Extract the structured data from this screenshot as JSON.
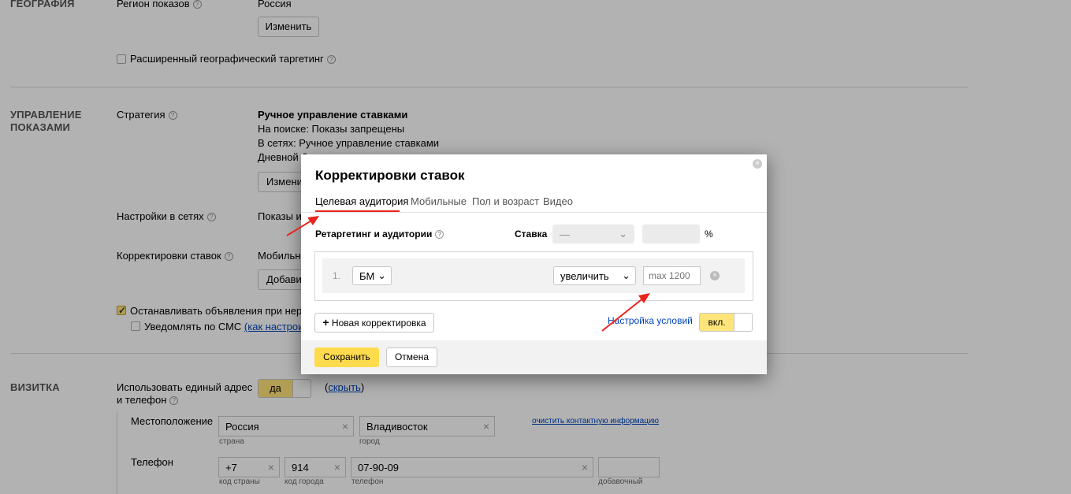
{
  "geo": {
    "section_title": "ГЕОГРАФИЯ",
    "region_label": "Регион показов",
    "region_value": "Россия",
    "change_button": "Изменить",
    "extended_targeting_label": "Расширенный географический таргетинг"
  },
  "management": {
    "section_title_line1": "УПРАВЛЕНИЕ",
    "section_title_line2": "ПОКАЗАМИ",
    "strategy_label": "Стратегия",
    "strategy_title": "Ручное управление ставками",
    "strategy_search": "На поиске: Показы запрещены",
    "strategy_networks": "В сетях: Ручное управление ставками",
    "strategy_daily": "Дневной б...",
    "change_button": "Измени",
    "networks_label": "Настройки в сетях",
    "networks_value": "Показы ид",
    "bid_adjust_label": "Корректировки ставок",
    "bid_adjust_value": "Мобильны",
    "add_button": "Добави",
    "stop_ads_label": "Останавливать объявления при неработ",
    "sms_label": "Уведомлять по СМС",
    "sms_link": "(как настроить?"
  },
  "card": {
    "section_title": "ВИЗИТКА",
    "use_single_label_line1": "Использовать единый адрес",
    "use_single_label_line2": "и телефон",
    "toggle_value": "да",
    "hide_link": "скрыть",
    "hide_open": "(",
    "hide_close": ")",
    "location_label": "Местоположение",
    "country_value": "Россия",
    "country_caption": "страна",
    "city_value": "Владивосток",
    "city_caption": "город",
    "clear_link": "очистить контактную информацию",
    "phone_label": "Телефон",
    "country_code_value": "+7",
    "country_code_caption": "код страны",
    "city_code_value": "914",
    "city_code_caption": "код города",
    "phone_value": "07-90-09",
    "phone_caption": "телефон",
    "ext_caption": "добавочный"
  },
  "modal": {
    "title": "Корректировки ставок",
    "tabs": [
      {
        "label": "Целевая аудитория",
        "active": true
      },
      {
        "label": "Мобильные",
        "active": false
      },
      {
        "label": "Пол и возраст",
        "active": false
      },
      {
        "label": "Видео",
        "active": false
      }
    ],
    "retargeting_label": "Ретаргетинг и аудитории",
    "bid_label": "Ставка",
    "bid_select_value": "—",
    "percent_sign": "%",
    "row": {
      "number": "1.",
      "segment_value": "БМ",
      "action_value": "увеличить",
      "amount_placeholder": "max 1200"
    },
    "new_adjustment_button": "Новая корректировка",
    "conditions_link": "Настройка условий",
    "toggle_value": "вкл.",
    "save_button": "Сохранить",
    "cancel_button": "Отмена"
  },
  "colors": {
    "accent_yellow": "#ffdb4d",
    "annotation_arrow": "#e8251c",
    "link_blue": "#0044bb"
  }
}
